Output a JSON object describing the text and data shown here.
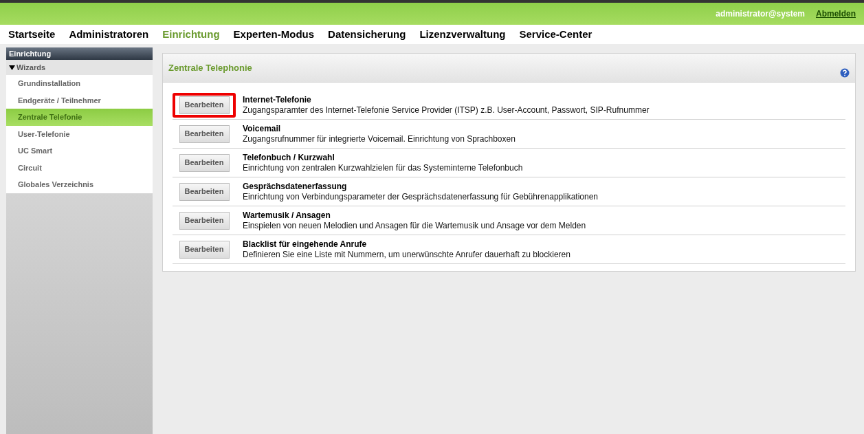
{
  "top_bar": {
    "user": "administrator@system",
    "logout": "Abmelden"
  },
  "nav": [
    {
      "label": "Startseite",
      "selected": false
    },
    {
      "label": "Administratoren",
      "selected": false
    },
    {
      "label": "Einrichtung",
      "selected": true
    },
    {
      "label": "Experten-Modus",
      "selected": false
    },
    {
      "label": "Datensicherung",
      "selected": false
    },
    {
      "label": "Lizenzverwaltung",
      "selected": false
    },
    {
      "label": "Service-Center",
      "selected": false
    }
  ],
  "sidebar": {
    "title": "Einrichtung",
    "group": {
      "label": "Wizards",
      "expanded": true,
      "items": [
        {
          "label": "Grundinstallation",
          "selected": false
        },
        {
          "label": "Endgeräte / Teilnehmer",
          "selected": false
        },
        {
          "label": "Zentrale Telefonie",
          "selected": true
        },
        {
          "label": "User-Telefonie",
          "selected": false
        },
        {
          "label": "UC Smart",
          "selected": false
        },
        {
          "label": "Circuit",
          "selected": false
        },
        {
          "label": "Globales Verzeichnis",
          "selected": false
        }
      ]
    }
  },
  "panel": {
    "title": "Zentrale Telephonie",
    "rows": [
      {
        "button": "Bearbeiten",
        "title": "Internet-Telefonie",
        "description": "Zugangsparamter des Internet-Telefonie Service Provider (ITSP) z.B. User-Account, Passwort, SIP-Rufnummer",
        "highlighted": true
      },
      {
        "button": "Bearbeiten",
        "title": "Voicemail",
        "description": "Zugangsrufnummer für integrierte Voicemail. Einrichtung von Sprachboxen",
        "highlighted": false
      },
      {
        "button": "Bearbeiten",
        "title": "Telefonbuch / Kurzwahl",
        "description": "Einrichtung von zentralen Kurzwahlzielen für das Systeminterne Telefonbuch",
        "highlighted": false
      },
      {
        "button": "Bearbeiten",
        "title": "Gesprächsdatenerfassung",
        "description": "Einrichtung von Verbindungsparameter der Gesprächsdatenerfassung für Gebührenapplikationen",
        "highlighted": false
      },
      {
        "button": "Bearbeiten",
        "title": "Wartemusik / Ansagen",
        "description": "Einspielen von neuen Melodien und Ansagen für die Wartemusik und Ansage vor dem Melden",
        "highlighted": false
      },
      {
        "button": "Bearbeiten",
        "title": "Blacklist für eingehende Anrufe",
        "description": "Definieren Sie eine Liste mit Nummern, um unerwünschte Anrufer dauerhaft zu blockieren",
        "highlighted": false
      }
    ]
  }
}
